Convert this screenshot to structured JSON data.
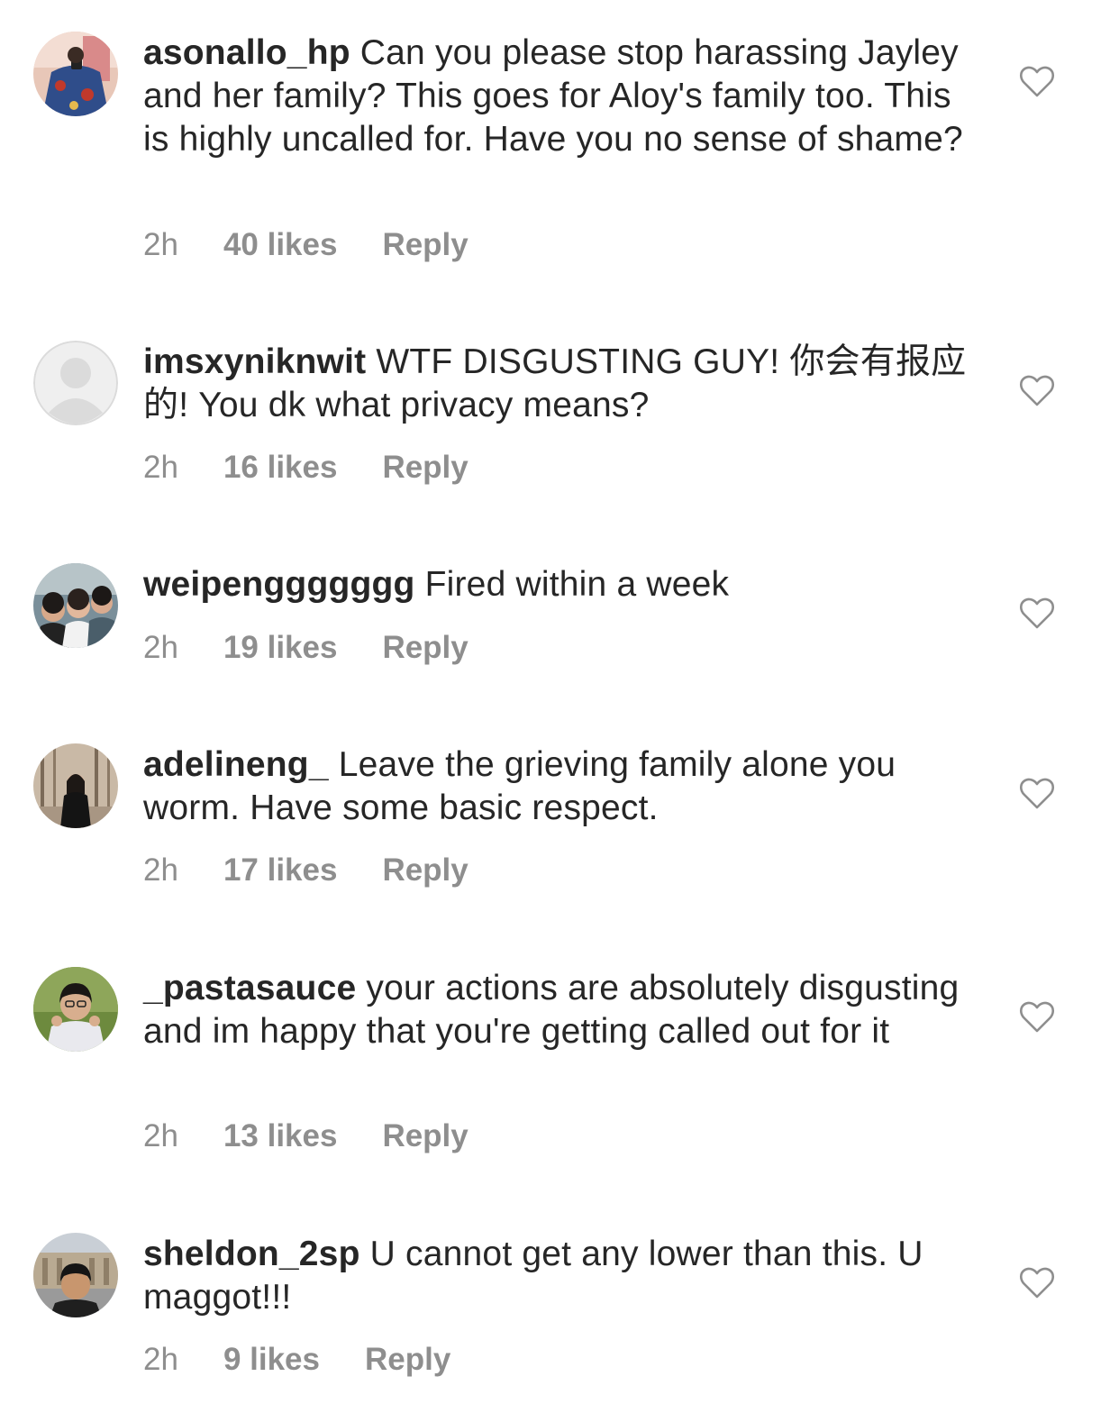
{
  "comments": [
    {
      "username": "asonallo_hp",
      "text": "Can you please stop harassing Jayley and her family? This goes for Aloy's family too. This is highly uncalled for. Have you no sense of shame?",
      "time": "2h",
      "likes": "40 likes",
      "reply": "Reply",
      "avatar": "profile-photo-mirror-selfie",
      "like_icon": "heart-outline-icon"
    },
    {
      "username": "imsxyniknwit",
      "text": "WTF DISGUSTING GUY! 你会有报应的! You dk what privacy means?",
      "time": "2h",
      "likes": "16 likes",
      "reply": "Reply",
      "avatar": "default-profile-placeholder",
      "like_icon": "heart-outline-icon"
    },
    {
      "username": "weipenggggggg",
      "text": "Fired within a week",
      "time": "2h",
      "likes": "19 likes",
      "reply": "Reply",
      "avatar": "profile-photo-group",
      "like_icon": "heart-outline-icon"
    },
    {
      "username": "adelineng_",
      "text": "Leave the grieving family alone you worm. Have some basic respect.",
      "time": "2h",
      "likes": "17 likes",
      "reply": "Reply",
      "avatar": "profile-photo-forest",
      "like_icon": "heart-outline-icon"
    },
    {
      "username": "_pastasauce",
      "text": "your actions are absolutely disgusting and im happy that you're getting called out for it",
      "time": "2h",
      "likes": "13 likes",
      "reply": "Reply",
      "avatar": "profile-photo-portrait",
      "like_icon": "heart-outline-icon"
    },
    {
      "username": "sheldon_2sp",
      "text": "U cannot get any lower than this. U maggot!!!",
      "time": "2h",
      "likes": "9 likes",
      "reply": "Reply",
      "avatar": "profile-photo-selfie-building",
      "like_icon": "heart-outline-icon"
    }
  ],
  "colors": {
    "text": "#262626",
    "meta": "#8e8e8e",
    "heart_stroke": "#8e8e8e",
    "placeholder_bg": "#efefef",
    "placeholder_fg": "#dbdbdb"
  }
}
